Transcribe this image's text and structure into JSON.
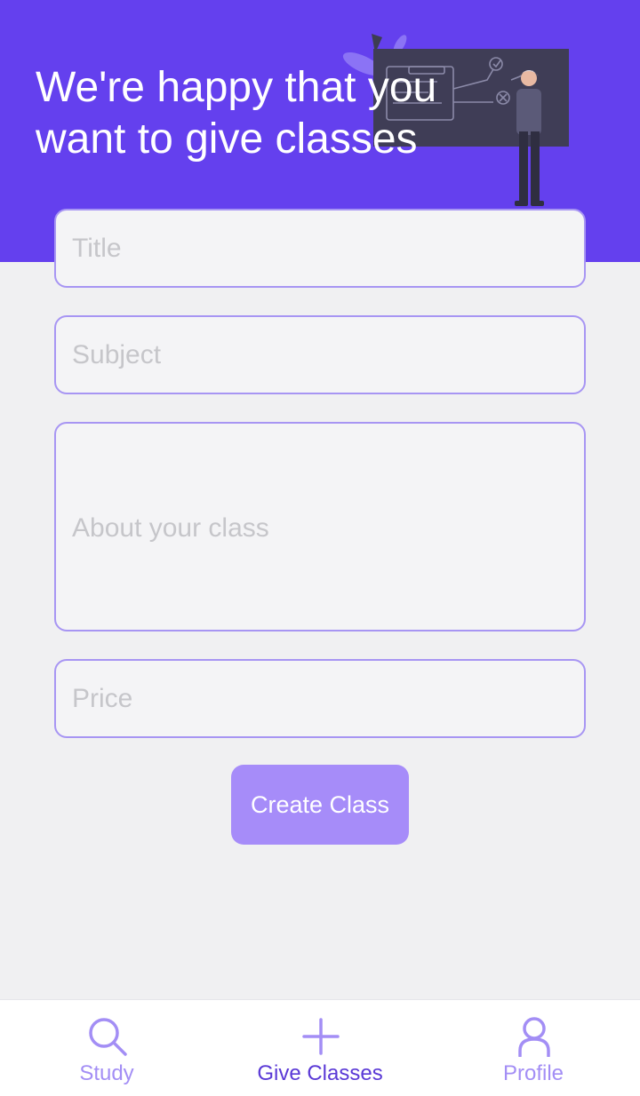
{
  "header": {
    "title": "We're happy that you\nwant to give classes"
  },
  "form": {
    "title_placeholder": "Title",
    "subject_placeholder": "Subject",
    "about_placeholder": "About your class",
    "price_placeholder": "Price",
    "submit_label": "Create Class"
  },
  "tabbar": {
    "items": [
      {
        "label": "Study",
        "icon": "search-icon",
        "active": false
      },
      {
        "label": "Give Classes",
        "icon": "plus-icon",
        "active": true
      },
      {
        "label": "Profile",
        "icon": "user-icon",
        "active": false
      }
    ]
  },
  "colors": {
    "header": "#6440ee",
    "field_border": "#a795f3",
    "button": "#a68cf9",
    "tab_inactive": "#a38ef5",
    "tab_active": "#5a39d6"
  }
}
